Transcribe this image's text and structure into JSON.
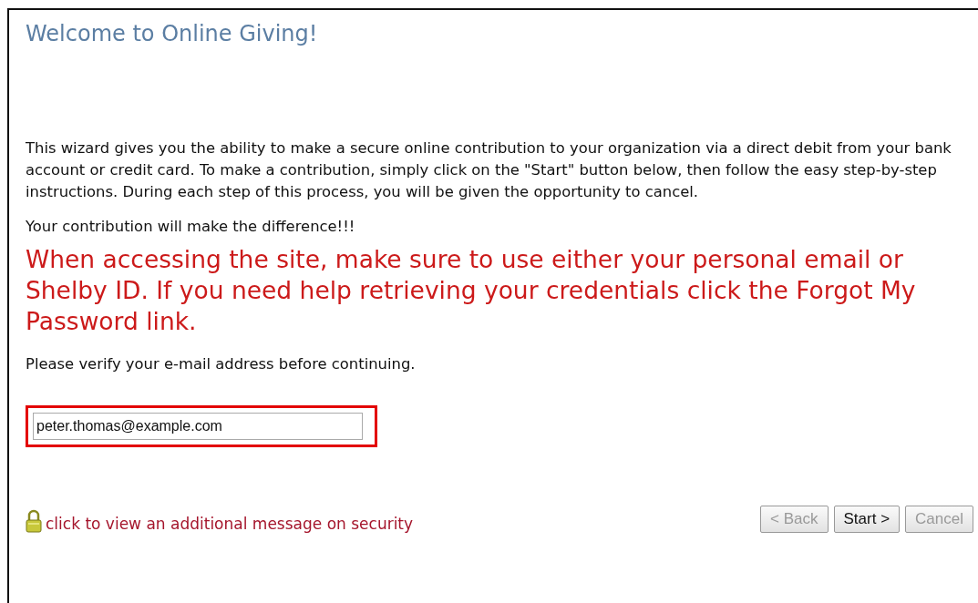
{
  "title": "Welcome to Online Giving!",
  "intro": "This wizard gives you the ability to make a secure online contribution to your organization via a direct debit from your bank account or credit card. To make a contribution, simply click on the \"Start\" button below, then follow the easy step-by-step instructions. During each step of this process, you will be given the opportunity to cancel.",
  "tagline": "Your contribution will make the difference!!!",
  "notice": "When accessing the site, make sure to use either your personal email or Shelby ID. If you need help retrieving your credentials click the Forgot My Password link.",
  "verify_prompt": "Please verify your e-mail address before continuing.",
  "email_field": {
    "value": "peter.thomas@example.com",
    "highlighted": true
  },
  "security_link": "click to view an additional message on security",
  "buttons": [
    {
      "label": "< Back",
      "disabled": true
    },
    {
      "label": "Start >",
      "disabled": false
    },
    {
      "label": "Cancel",
      "disabled": true
    }
  ]
}
